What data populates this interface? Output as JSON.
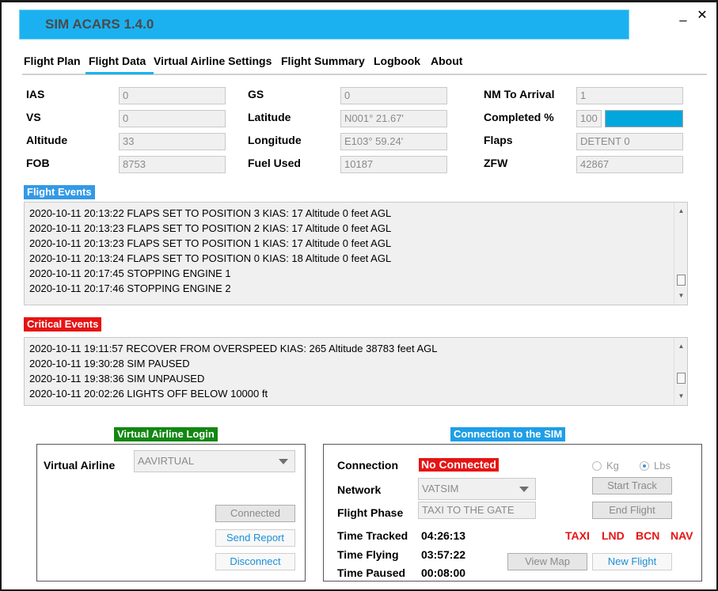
{
  "window": {
    "title": "SIM ACARS  1.4.0",
    "minimize": "_",
    "close": "✕"
  },
  "tabs": [
    "Flight Plan",
    "Flight Data",
    "Virtual Airline Settings",
    "Flight Summary",
    "Logbook",
    "About"
  ],
  "flight_data": {
    "ias_label": "IAS",
    "ias": "0",
    "vs_label": "VS",
    "vs": "0",
    "altitude_label": "Altitude",
    "altitude": "33",
    "fob_label": "FOB",
    "fob": "8753",
    "gs_label": "GS",
    "gs": "0",
    "latitude_label": "Latitude",
    "latitude": "N001° 21.67'",
    "longitude_label": "Longitude",
    "longitude": "E103° 59.24'",
    "fuel_used_label": "Fuel Used",
    "fuel_used": "10187",
    "nm_to_arrival_label": "NM To Arrival",
    "nm_to_arrival": "1",
    "completed_label": "Completed  %",
    "completed": "100",
    "completed_fraction": 1.0,
    "flaps_label": "Flaps",
    "flaps": "DETENT 0",
    "zfw_label": "ZFW",
    "zfw": "42867"
  },
  "flight_events": {
    "title": "Flight Events",
    "lines": [
      "2020-10-11 20:13:22 FLAPS SET TO POSITION 3  KIAS: 17 Altitude 0 feet AGL",
      "2020-10-11 20:13:23 FLAPS SET TO POSITION 2  KIAS: 17 Altitude 0 feet AGL",
      "2020-10-11 20:13:23 FLAPS SET TO POSITION 1  KIAS: 17 Altitude 0 feet AGL",
      "2020-10-11 20:13:24 FLAPS SET TO POSITION 0  KIAS: 18 Altitude 0 feet AGL",
      "2020-10-11 20:17:45 STOPPING ENGINE 1",
      "2020-10-11 20:17:46 STOPPING ENGINE 2"
    ]
  },
  "critical_events": {
    "title": "Critical Events",
    "lines": [
      "2020-10-11 19:11:57 RECOVER FROM OVERSPEED  KIAS: 265 Altitude 38783 feet AGL",
      "2020-10-11 19:30:28 SIM PAUSED",
      "2020-10-11 19:38:36 SIM UNPAUSED",
      "2020-10-11 20:02:26 LIGHTS OFF BELOW 10000 ft"
    ]
  },
  "va_login": {
    "title": "Virtual Airline Login",
    "airline_label": "Virtual Airline",
    "airline_value": "AAVIRTUAL",
    "connected_button": "Connected",
    "send_report_button": "Send Report",
    "disconnect_button": "Disconnect"
  },
  "sim_connection": {
    "title": "Connection to the SIM",
    "connection_label": "Connection",
    "connection_status": "No Connected",
    "network_label": "Network",
    "network_value": "VATSIM",
    "phase_label": "Flight Phase",
    "phase_value": "TAXI TO THE GATE",
    "kg_label": "Kg",
    "lbs_label": "Lbs",
    "start_track_button": "Start Track",
    "end_flight_button": "End Flight",
    "time_tracked_label": "Time Tracked",
    "time_tracked": "04:26:13",
    "time_flying_label": "Time Flying",
    "time_flying": "03:57:22",
    "time_paused_label": "Time Paused",
    "time_paused": "00:08:00",
    "lights": [
      "TAXI",
      "LND",
      "BCN",
      "NAV"
    ],
    "view_map_button": "View Map",
    "new_flight_button": "New Flight"
  },
  "colors": {
    "accent": "#1bb1f0",
    "flight_events_tag": "#3399e6",
    "critical_events_tag": "#e61414",
    "va_login_tag": "#128712",
    "sim_connection_tag": "#1f9ee6",
    "progress_fill": "#00a6dc"
  }
}
